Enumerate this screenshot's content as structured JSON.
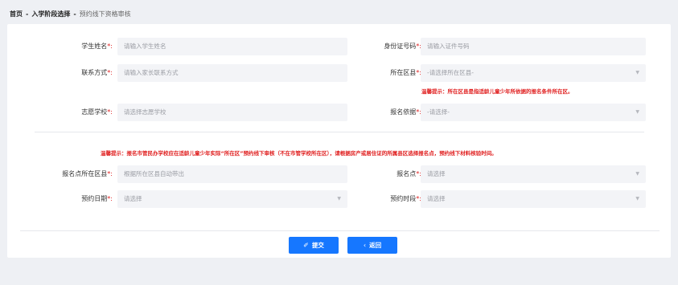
{
  "breadcrumb": {
    "home": "首页",
    "stage": "入学阶段选择",
    "current": "预约线下资格审核",
    "separator": "-"
  },
  "form": {
    "required_mark": "*:",
    "student_name": {
      "label": "学生姓名",
      "placeholder": "请输入学生姓名"
    },
    "id_number": {
      "label": "身份证号码",
      "placeholder": "请输入证件号码"
    },
    "contact": {
      "label": "联系方式",
      "placeholder": "请输入家长联系方式"
    },
    "district": {
      "label": "所在区县",
      "placeholder": "-请选择所在区县-"
    },
    "district_hint": "温馨提示：所在区县是指适龄儿童少年所依据的报名条件所在区。",
    "school": {
      "label": "志愿学校",
      "placeholder": "请选择志愿学校"
    },
    "basis": {
      "label": "报名依据",
      "placeholder": "-请选择-"
    },
    "notice": "温馨提示：报名市管民办学校应在适龄儿童少年实际“所在区”预约线下审核（不在市管学校所在区），请根据房产或居住证的所属县区选择报名点，预约线下材料核验时间。",
    "signup_district": {
      "label": "报名点所在区县",
      "placeholder": "根据所在区县自动带出"
    },
    "signup_point": {
      "label": "报名点",
      "placeholder": "请选择"
    },
    "date": {
      "label": "预约日期",
      "placeholder": "请选择"
    },
    "period": {
      "label": "预约时段",
      "placeholder": "请选择"
    }
  },
  "icons": {
    "dropdown": "chevron-down-icon",
    "submit": "send-icon",
    "back": "chevron-left-icon"
  },
  "actions": {
    "submit": "提交",
    "back": "返回"
  },
  "colors": {
    "primary": "#1677ff",
    "required": "#e02020",
    "input_bg": "#f3f4f7",
    "page_bg": "#eef0f4"
  }
}
